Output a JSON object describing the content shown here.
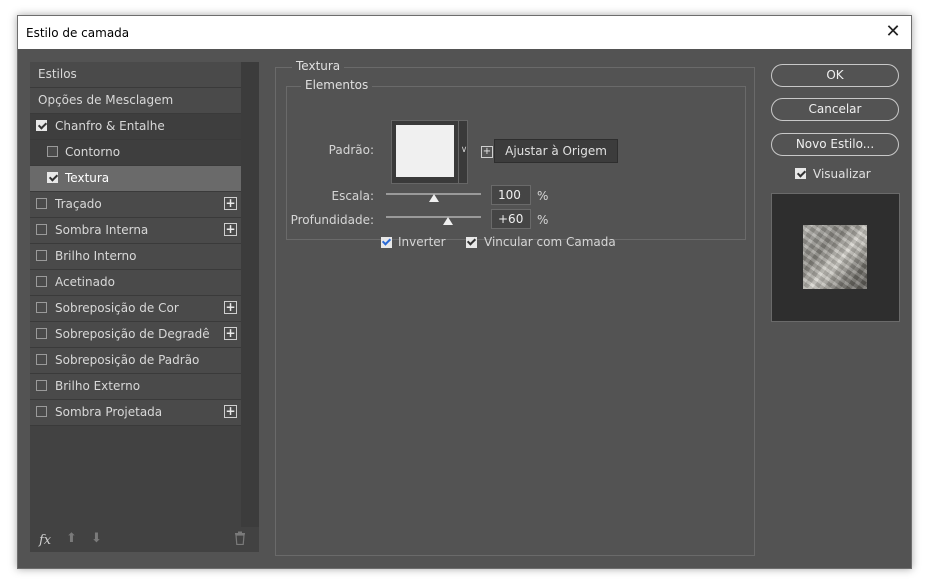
{
  "window": {
    "title": "Estilo de camada"
  },
  "sidebar": {
    "items": [
      {
        "label": "Estilos",
        "checkbox": null,
        "checked": false,
        "plus": false,
        "indent": false
      },
      {
        "label": "Opções de Mesclagem",
        "checkbox": null,
        "checked": false,
        "plus": false,
        "indent": false
      },
      {
        "label": "Chanfro & Entalhe",
        "checkbox": true,
        "checked": true,
        "plus": false,
        "indent": false
      },
      {
        "label": "Contorno",
        "checkbox": true,
        "checked": false,
        "plus": false,
        "indent": true
      },
      {
        "label": "Textura",
        "checkbox": true,
        "checked": true,
        "plus": false,
        "indent": true,
        "selected": true
      },
      {
        "label": "Traçado",
        "checkbox": true,
        "checked": false,
        "plus": true,
        "indent": false
      },
      {
        "label": "Sombra Interna",
        "checkbox": true,
        "checked": false,
        "plus": true,
        "indent": false
      },
      {
        "label": "Brilho Interno",
        "checkbox": true,
        "checked": false,
        "plus": false,
        "indent": false
      },
      {
        "label": "Acetinado",
        "checkbox": true,
        "checked": false,
        "plus": false,
        "indent": false
      },
      {
        "label": "Sobreposição de Cor",
        "checkbox": true,
        "checked": false,
        "plus": true,
        "indent": false
      },
      {
        "label": "Sobreposição de Degradê",
        "checkbox": true,
        "checked": false,
        "plus": true,
        "indent": false
      },
      {
        "label": "Sobreposição de Padrão",
        "checkbox": true,
        "checked": false,
        "plus": false,
        "indent": false
      },
      {
        "label": "Brilho Externo",
        "checkbox": true,
        "checked": false,
        "plus": false,
        "indent": false
      },
      {
        "label": "Sombra Projetada",
        "checkbox": true,
        "checked": false,
        "plus": true,
        "indent": false
      }
    ],
    "footer": {
      "fx": "fx"
    }
  },
  "main": {
    "section_title": "Textura",
    "group_title": "Elementos",
    "pattern_label": "Padrão:",
    "snap_button": "Ajustar à Origem",
    "scale_label": "Escala:",
    "scale_value": "100",
    "scale_unit": "%",
    "scale_fraction": 0.5,
    "depth_label": "Profundidade:",
    "depth_value": "+60",
    "depth_unit": "%",
    "depth_fraction": 0.65,
    "invert_label": "Inverter",
    "invert_checked": true,
    "link_label": "Vincular com Camada",
    "link_checked": true
  },
  "actions": {
    "ok": "OK",
    "cancel": "Cancelar",
    "new_style": "Novo Estilo...",
    "preview_label": "Visualizar",
    "preview_checked": true
  }
}
